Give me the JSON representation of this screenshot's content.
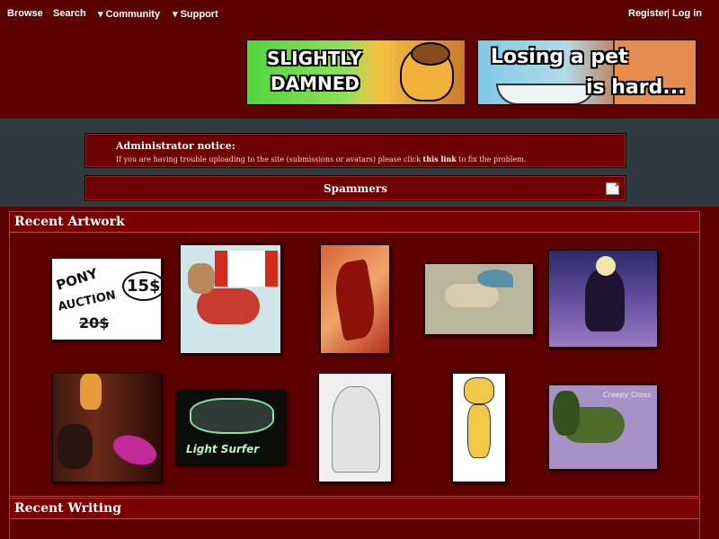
{
  "nav": {
    "browse": "Browse",
    "search": "Search",
    "community": "▾ Community",
    "support": "▾ Support",
    "register": "Register",
    "separator": "|",
    "login": "Log in"
  },
  "banners": {
    "banner1_line1": "SLIGHTLY",
    "banner1_line2": "DAMNED",
    "banner2_line1": "Losing a pet",
    "banner2_line2": "is hard..."
  },
  "notice": {
    "title": "Administrator notice:",
    "body_before": "If you are having trouble uploading to the site (submissions or avatars) please click ",
    "link": "this link",
    "body_after": " to fix the problem."
  },
  "spam": {
    "title": "Spammers",
    "icon": "close-notice-icon"
  },
  "recent_artwork": {
    "heading": "Recent Artwork",
    "thumbnails": [
      {
        "name": "pony-auction",
        "text": [
          "PONY",
          "AUCTION",
          "15$",
          "20$"
        ]
      },
      {
        "name": "canada-pony"
      },
      {
        "name": "red-fox-abstract"
      },
      {
        "name": "winged-creature-ref"
      },
      {
        "name": "night-pony"
      },
      {
        "name": "forest-creatures"
      },
      {
        "name": "light-surfer",
        "text": [
          "Light Surfer"
        ]
      },
      {
        "name": "anubis-sketch"
      },
      {
        "name": "cheetah-cat"
      },
      {
        "name": "creepy-cross-pony",
        "text": [
          "Creepy Cross"
        ]
      }
    ]
  },
  "recent_writing": {
    "heading": "Recent Writing"
  },
  "colors": {
    "background": "#5a0000",
    "band": "#2d3a40",
    "panel_head": "#7a0000"
  }
}
